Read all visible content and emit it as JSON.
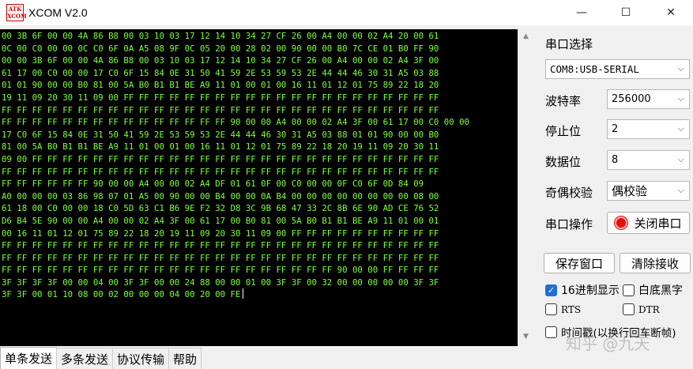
{
  "window": {
    "icon_text": "ATK XCOM",
    "title": "XCOM V2.0",
    "controls": {
      "minimize": "—",
      "maximize": "☐",
      "close": "✕"
    }
  },
  "terminal": {
    "lines": [
      "00 3B 6F 00 00 4A 86 B8 00 03 10 03 17 12 14 10 34 27 CF 26 00 A4 00 00 02 A4 20 00 61",
      "0C 00 C0 00 00 0C C0 6F 0A A5 08 9F 0C 05 20 00 28 02 00 90 00 00 B0 7C CE 01 B0 FF 90",
      "00 00 3B 6F 00 00 4A 86 B8 00 03 10 03 17 12 14 10 34 27 CF 26 00 A4 00 00 02 A4 3F 00",
      "61 17 00 C0 00 00 17 C0 6F 15 84 0E 31 50 41 59 2E 53 59 53 2E 44 44 46 30 31 A5 03 88",
      "01 01 90 00 00 B0 81 00 5A B0 B1 B1 BE A9 11 01 00 01 00 16 11 01 12 01 75 89 22 18 20",
      "19 11 09 20 30 11 09 00 FF FF FF FF FF FF FF FF FF FF FF FF FF FF FF FF FF FF FF FF FF",
      "FF FF FF FF FF FF FF FF FF FF FF FF FF FF FF FF FF FF FF FF FF FF FF FF FF FF FF FF FF",
      "FF FF FF FF FF FF FF FF FF FF FF FF FF FF FF 90 00 00 A4 00 00 02 A4 3F 00 61 17 00 C0 00 00",
      "17 C0 6F 15 84 0E 31 50 41 59 2E 53 59 53 2E 44 44 46 30 31 A5 03 88 01 01 90 00 00 B0",
      "81 00 5A B0 B1 B1 BE A9 11 01 00 01 00 16 11 01 12 01 75 89 22 18 20 19 11 09 20 30 11",
      "09 00 FF FF FF FF FF FF FF FF FF FF FF FF FF FF FF FF FF FF FF FF FF FF FF FF FF FF FF",
      "FF FF FF FF FF FF FF FF FF FF FF FF FF FF FF FF FF FF FF FF FF FF FF FF FF FF FF FF FF",
      "FF FF FF FF FF FF 90 00 00 A4 00 00 02 A4 DF 01 61 0F 00 C0 00 00 0F C0 6F 0D 84 09",
      "A0 00 00 00 03 86 98 07 01 A5 00 90 00 00 B4 00 00 0A B4 00 00 00 00 00 00 00 00 08 00",
      "61 18 00 C0 00 00 18 C0 5D 63 C1 B6 9E F2 32 D8 3C 9B 68 47 33 2C 8B 6E 90 AD CE 76 52",
      "D6 B4 5E 90 00 00 A4 00 00 02 A4 3F 00 61 17 00 B0 81 00 5A B0 B1 B1 BE A9 11 01 00 01",
      "00 16 11 01 12 01 75 89 22 18 20 19 11 09 20 30 11 09 00 FF FF FF FF FF FF FF FF FF FF",
      "FF FF FF FF FF FF FF FF FF FF FF FF FF FF FF FF FF FF FF FF FF FF FF FF FF FF FF FF FF",
      "FF FF FF FF FF FF FF FF FF FF FF FF FF FF FF FF FF FF FF FF FF FF FF FF FF FF FF FF FF",
      "FF FF FF FF FF FF FF FF FF FF FF FF FF FF FF FF FF FF FF FF FF FF 90 00 00 FF FF FF FF",
      "3F 3F 3F 3F 00 00 04 00 3F 3F 00 00 24 88 00 00 01 00 3F 3F 00 32 00 00 00 00 00 3F 3F",
      "3F 3F 00 01 10 08 00 02 00 00 00 04 00 20 00 FE"
    ],
    "text_color": "#7fff3a"
  },
  "panel": {
    "port_select_label": "串口选择",
    "port_value": "COM8:USB-SERIAL",
    "baud_label": "波特率",
    "baud_value": "256000",
    "stopbits_label": "停止位",
    "stopbits_value": "2",
    "databits_label": "数据位",
    "databits_value": "8",
    "parity_label": "奇偶校验",
    "parity_value": "偶校验",
    "port_op_label": "串口操作",
    "close_port_button": "关闭串口",
    "save_window_button": "保存窗口",
    "clear_rx_button": "清除接收",
    "hex_display_label": "16进制显示",
    "white_black_label": "白底黑字",
    "rts_label": "RTS",
    "dtr_label": "DTR",
    "timestamp_label": "时间戳(以换行回车断帧)",
    "hex_display_checked": true,
    "white_black_checked": false,
    "rts_checked": false,
    "dtr_checked": false,
    "timestamp_checked": false
  },
  "tabs": [
    {
      "label": "单条发送",
      "active": true
    },
    {
      "label": "多条发送",
      "active": false
    },
    {
      "label": "协议传输",
      "active": false
    },
    {
      "label": "帮助",
      "active": false
    }
  ],
  "watermark": "知乎 @九天"
}
